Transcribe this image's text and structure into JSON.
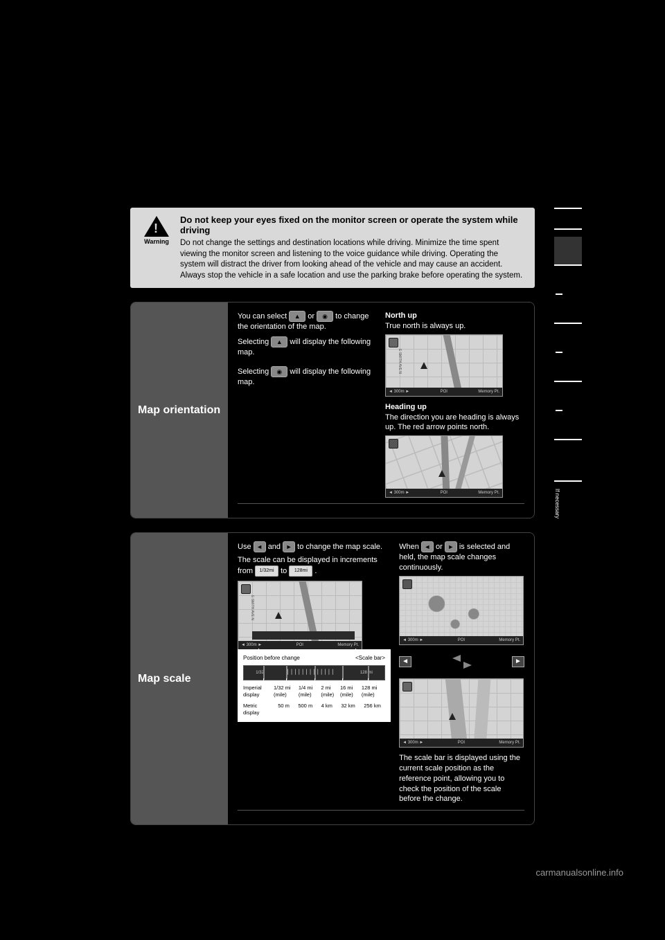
{
  "warning": {
    "label": "Warning",
    "title": "Do not keep your eyes fixed on the monitor screen or operate the system while driving",
    "body": "Do not change the settings and destination locations while driving. Minimize the time spent viewing the monitor screen and listening to the voice guidance while driving. Operating the system will distract the driver from looking ahead of the vehicle and may cause an accident. Always stop the vehicle in a safe location and use the parking brake before operating the system."
  },
  "orientation": {
    "heading": "Map orientation",
    "intro_a": "You can select ",
    "intro_b": " or ",
    "intro_c": " to change the orientation of the map.",
    "caption_prefix": "Selecting ",
    "caption_suffix": " will display the following map.",
    "north_up": "North up",
    "north_up_desc": "True north is always up.",
    "heading_up": "Heading up",
    "heading_up_desc": "The direction you are heading is always up. The red arrow points north.",
    "street_label": "E SMITH AVE N",
    "bottom_left": "◄ 300m ►",
    "bottom_poi": "POI",
    "bottom_mem": "Memory Pt."
  },
  "scale": {
    "heading": "Map scale",
    "intro_a": "Use ",
    "intro_b": " and ",
    "intro_c": " to change the map scale.",
    "scale_line": "The scale can be displayed in increments from ",
    "scale_to": " to ",
    "scale_end": ".",
    "btn_min": "1/32mi",
    "btn_max": "128mi",
    "hold_a": "When ",
    "hold_b": " or ",
    "hold_c": " is selected and held, the map scale changes continuously.",
    "bar_note": "The scale bar is displayed using the current scale position as the reference point, allowing you to check the position of the scale before the change.",
    "pos_before": "Position before change",
    "scale_bar_label": "<Scale bar>",
    "strip_left": "1/32",
    "strip_right": "128 mi",
    "row_imperial_label": "Imperial display",
    "row_metric_label": "Metric display",
    "imperial": [
      "1/32 mi (mile)",
      "1/4 mi (mile)",
      "2 mi (mile)",
      "16 mi (mile)",
      "128 mi (mile)"
    ],
    "metric": [
      "50 m",
      "500 m",
      "4 km",
      "32 km",
      "256 km"
    ],
    "bottom_left": "◄ 300m ►",
    "bottom_poi": "POI",
    "bottom_mem": "Memory Pt."
  },
  "side_tab": "If necessary",
  "footer": "carmanualsonline.info"
}
